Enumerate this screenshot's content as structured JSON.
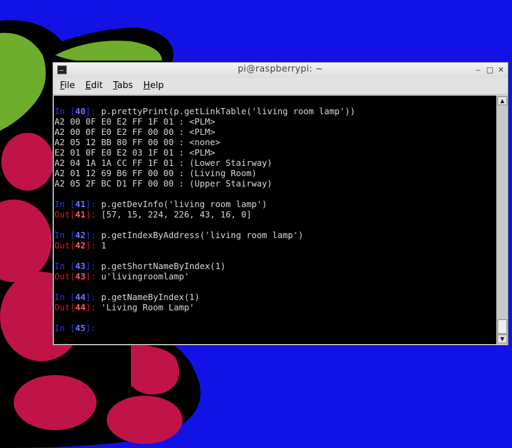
{
  "window": {
    "title": "pi@raspberrypi: ~",
    "minimize_glyph": "‒",
    "maximize_glyph": "□",
    "close_glyph": "✕"
  },
  "menubar": {
    "items": [
      {
        "mnemonic": "F",
        "rest": "ile"
      },
      {
        "mnemonic": "E",
        "rest": "dit"
      },
      {
        "mnemonic": "T",
        "rest": "abs"
      },
      {
        "mnemonic": "H",
        "rest": "elp"
      }
    ]
  },
  "terminal": {
    "lines": [
      {
        "type": "in",
        "num": "40",
        "code": "p.prettyPrint(p.getLinkTable('living room lamp'))"
      },
      {
        "type": "text",
        "text": "A2 00 0F E0 E2 FF 1F 01 : <PLM>"
      },
      {
        "type": "text",
        "text": "A2 00 0F E0 E2 FF 00 00 : <PLM>"
      },
      {
        "type": "text",
        "text": "A2 05 12 BB 80 FF 00 00 : <none>"
      },
      {
        "type": "text",
        "text": "E2 01 0F E0 E2 03 1F 01 : <PLM>"
      },
      {
        "type": "text",
        "text": "A2 04 1A 1A CC FF 1F 01 : (Lower Stairway)"
      },
      {
        "type": "text",
        "text": "A2 01 12 69 B6 FF 00 00 : (Living Room)"
      },
      {
        "type": "text",
        "text": "A2 05 2F BC D1 FF 00 00 : (Upper Stairway)"
      },
      {
        "type": "blank"
      },
      {
        "type": "in",
        "num": "41",
        "code": "p.getDevInfo('living room lamp')"
      },
      {
        "type": "out",
        "num": "41",
        "code": "[57, 15, 224, 226, 43, 16, 0]"
      },
      {
        "type": "blank"
      },
      {
        "type": "in",
        "num": "42",
        "code": "p.getIndexByAddress('living room lamp')"
      },
      {
        "type": "out",
        "num": "42",
        "code": "1"
      },
      {
        "type": "blank"
      },
      {
        "type": "in",
        "num": "43",
        "code": "p.getShortNameByIndex(1)"
      },
      {
        "type": "out",
        "num": "43",
        "code": "u'livingroomlamp'"
      },
      {
        "type": "blank"
      },
      {
        "type": "in",
        "num": "44",
        "code": "p.getNameByIndex(1)"
      },
      {
        "type": "out",
        "num": "44",
        "code": "'Living Room Lamp'"
      },
      {
        "type": "blank"
      },
      {
        "type": "in",
        "num": "45",
        "code": ""
      }
    ]
  },
  "scrollbar": {
    "up_glyph": "▲",
    "down_glyph": "▼"
  },
  "colors": {
    "desktop": "#1212e6",
    "leaf": "#6fad2c",
    "berry": "#c01448",
    "prompt_in": "#6d72ff",
    "prompt_out": "#ff5a5a"
  }
}
